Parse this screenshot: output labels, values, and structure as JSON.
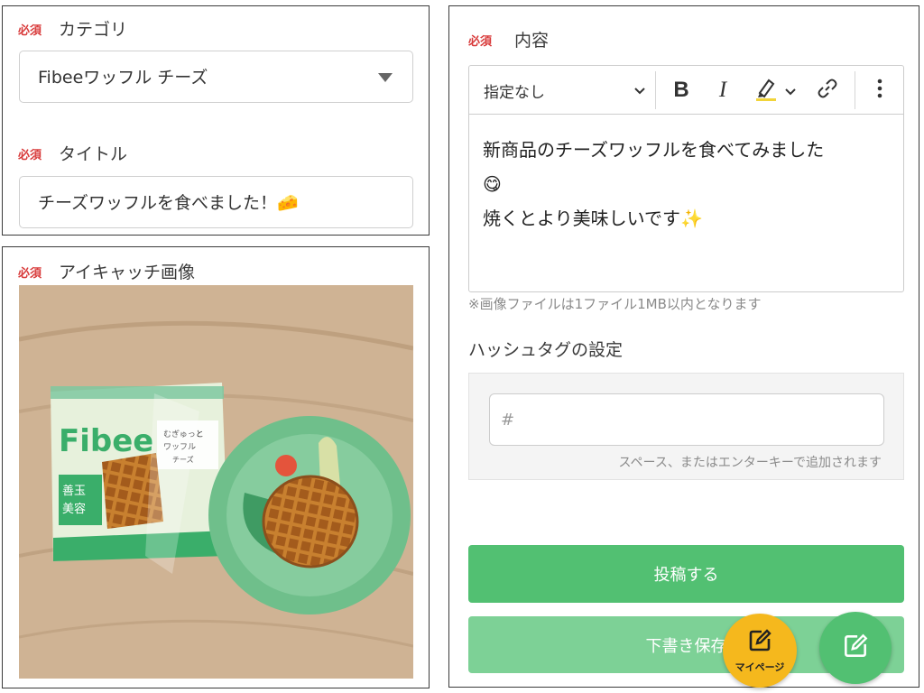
{
  "form": {
    "required_label": "必須",
    "category": {
      "label": "カテゴリ",
      "value": "Fibeeワッフル チーズ"
    },
    "title": {
      "label": "タイトル",
      "value": "チーズワッフルを食べました！🧀"
    },
    "eyecatch": {
      "label": "アイキャッチ画像",
      "package_brand": "Fibee",
      "package_tagline": "むぎゅっと ワッフル",
      "package_flavor": "チーズ"
    },
    "content": {
      "label": "内容",
      "format_select": "指定なし",
      "lines": [
        "新商品のチーズワッフルを食べてみました",
        "😋",
        "焼くとより美味しいです✨"
      ],
      "note": "※画像ファイルは1ファイル1MB以内となります"
    },
    "hashtag": {
      "heading": "ハッシュタグの設定",
      "placeholder": "#",
      "hint": "スペース、またはエンターキーで追加されます"
    },
    "buttons": {
      "submit": "投稿する",
      "draft": "下書き保存"
    }
  },
  "fab": {
    "mypage_label": "マイページ"
  },
  "colors": {
    "required": "#d83a3a",
    "primary_green": "#52c072",
    "light_green": "#7dd196",
    "fab_yellow": "#f5b81d"
  },
  "icons": [
    "chevron-down-icon",
    "bold-icon",
    "italic-icon",
    "highlighter-icon",
    "link-icon",
    "more-vertical-icon",
    "edit-icon"
  ]
}
